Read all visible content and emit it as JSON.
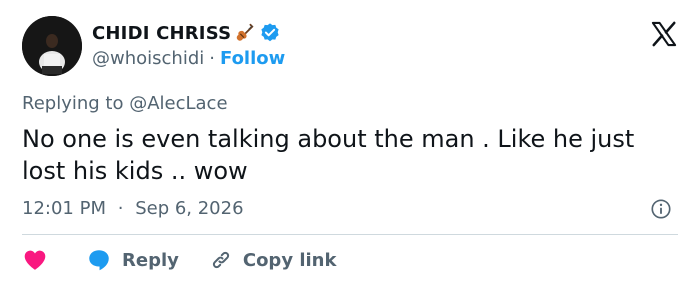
{
  "author": {
    "display_name": "CHIDI CHRISS",
    "name_emoji_icon": "violin-icon",
    "verified_icon": "verified-badge-icon",
    "handle": "@whoischidi",
    "separator": "·",
    "follow_label": "Follow"
  },
  "platform_icon": "x-logo-icon",
  "reply_context": {
    "prefix": "Replying to ",
    "mention": "@AlecLace"
  },
  "tweet": {
    "text": "No one is even talking about the man . Like he just lost his kids .. wow",
    "time": "12:01 PM",
    "date_separator": "·",
    "date": "Sep 6, 2026"
  },
  "actions": {
    "like_icon": "heart-icon",
    "reply_label": "Reply",
    "copy_label": "Copy link"
  },
  "colors": {
    "accent": "#1d9bf0",
    "heart": "#f91880",
    "muted_text": "#536471",
    "divider": "#cfd9de"
  }
}
